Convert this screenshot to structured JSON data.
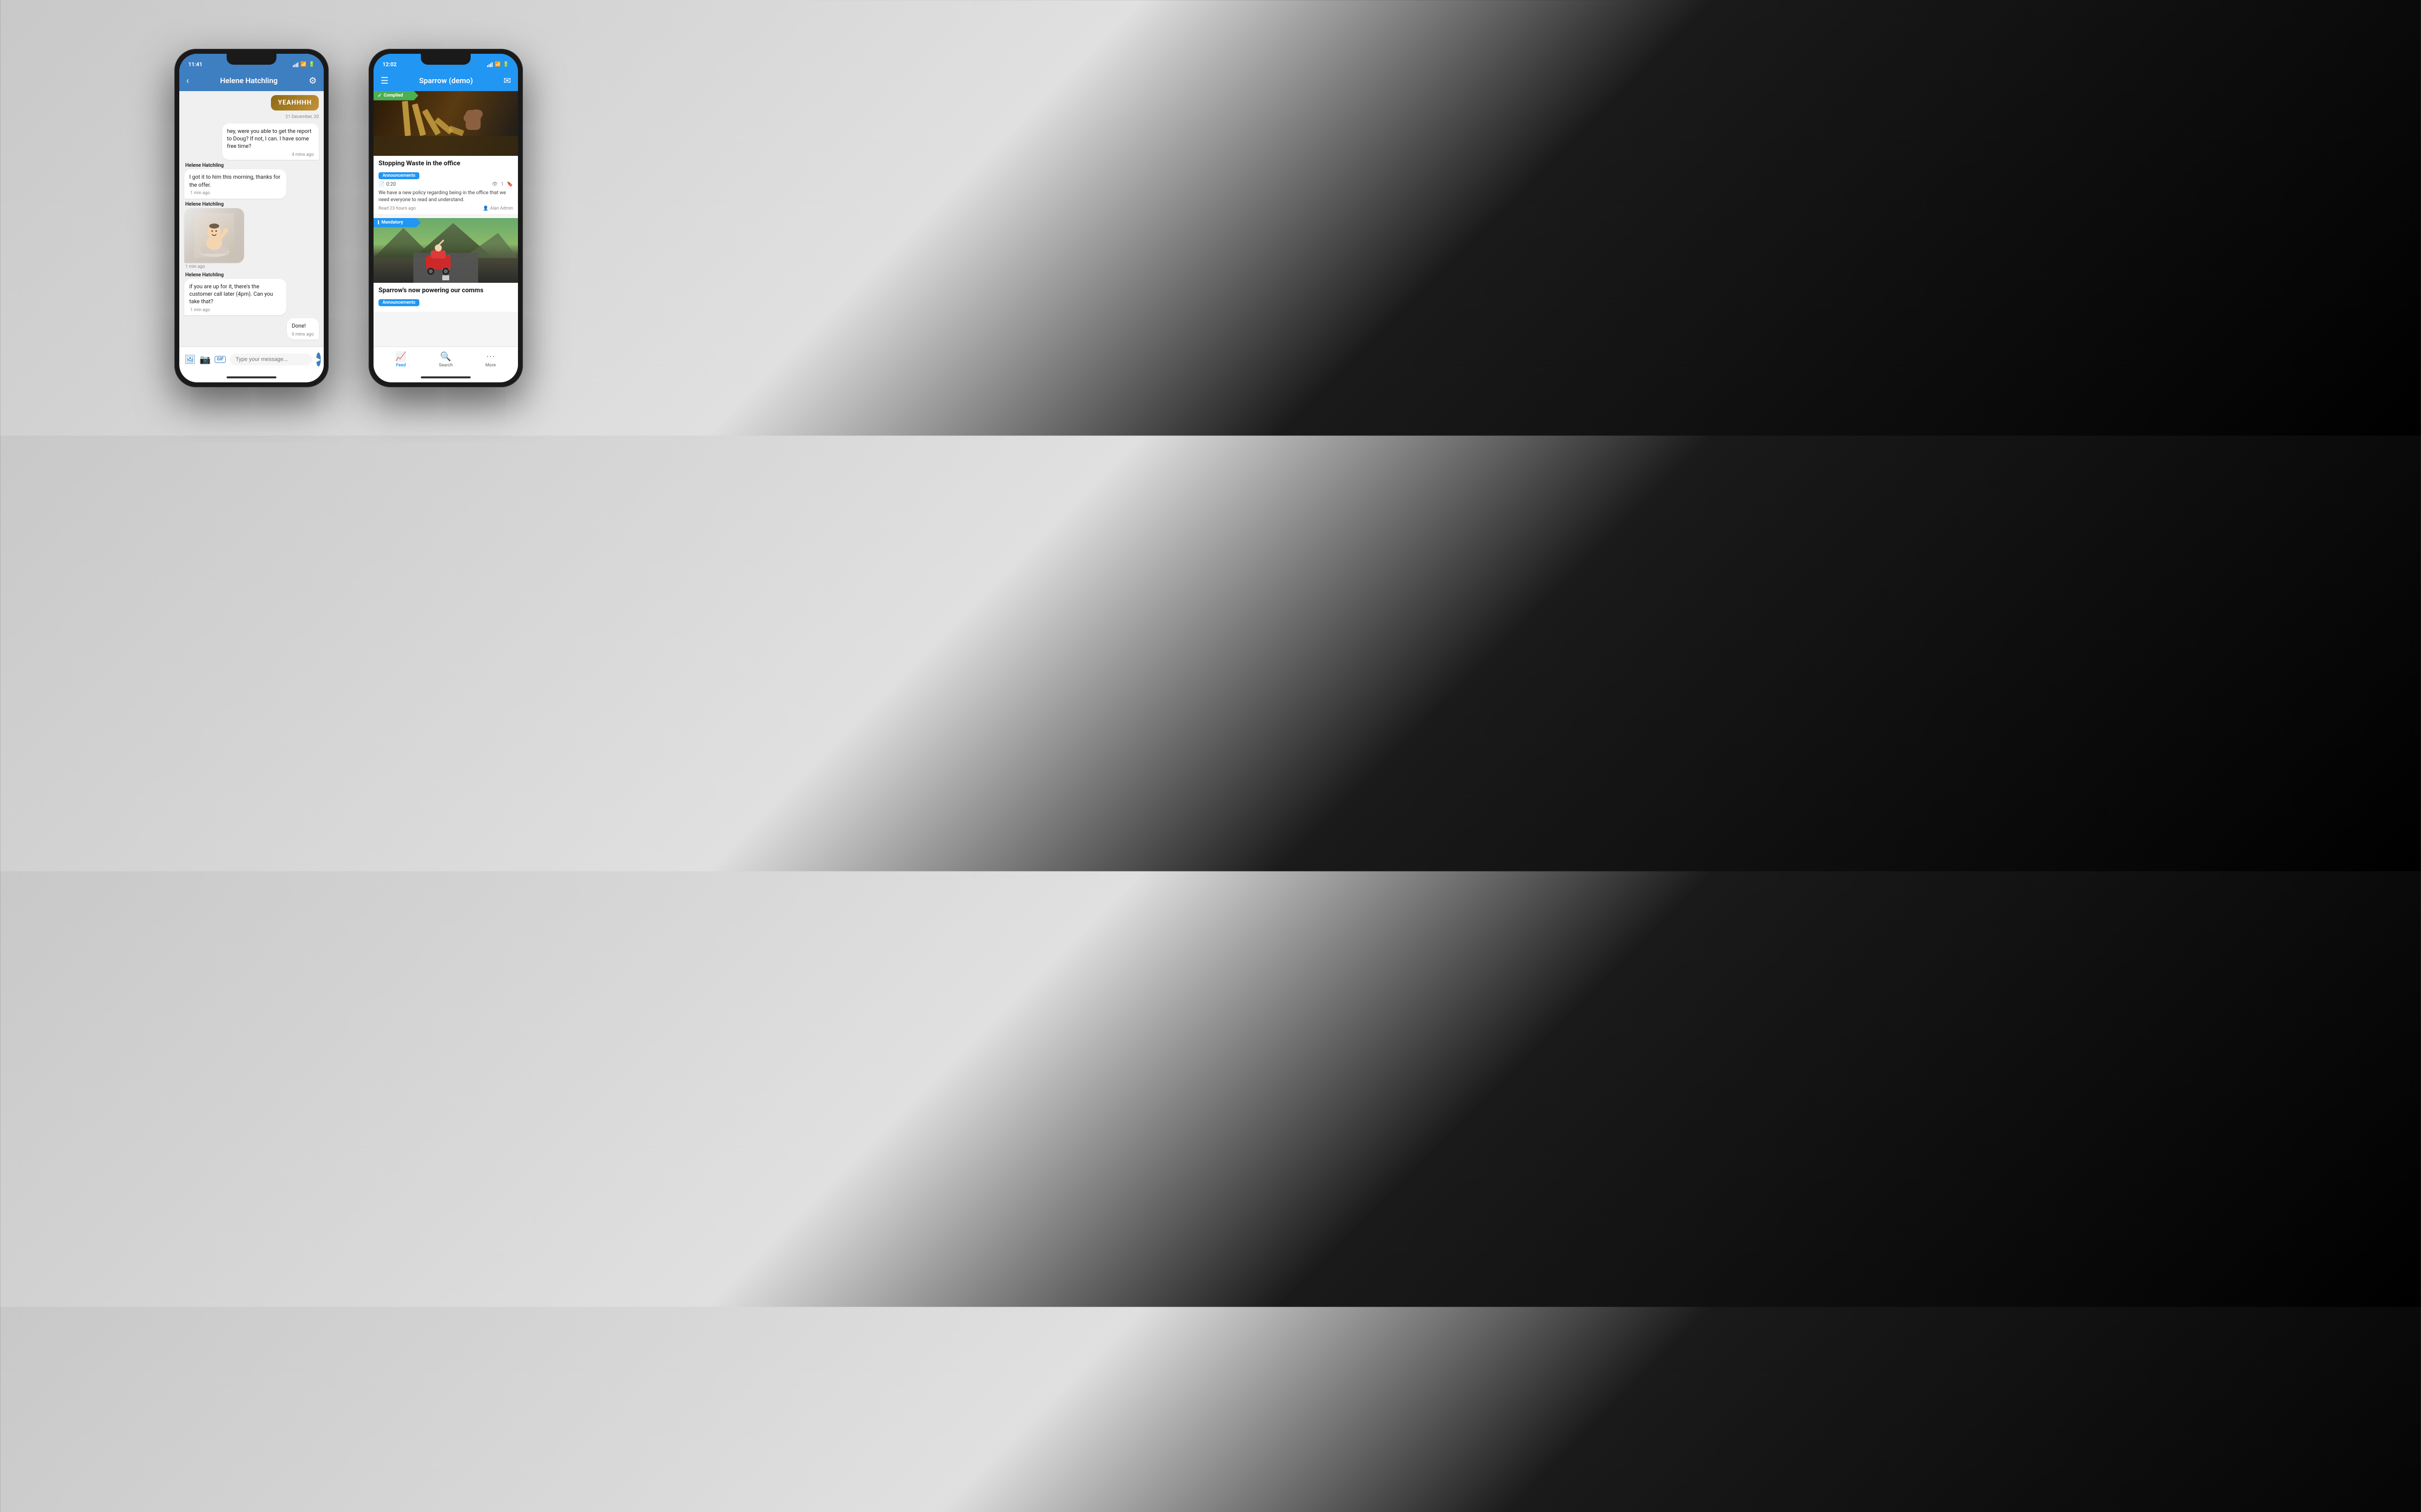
{
  "phone1": {
    "status": {
      "time": "11:41",
      "location_arrow": "▶"
    },
    "header": {
      "back_label": "‹",
      "title": "Helene Hatchling",
      "settings_icon": "⚙"
    },
    "messages": [
      {
        "id": "msg1",
        "type": "sent_image",
        "label": "YEAHHHH",
        "date": "21 December, 20"
      },
      {
        "id": "msg2",
        "type": "sent_text",
        "text": "hey, were you able to get the report to Doug? If not, I can. I have some free time?",
        "time": "4 mins ago"
      },
      {
        "id": "msg3",
        "type": "received_text",
        "sender": "Helene Hatchling",
        "text": "I got it to him this morning, thanks for the offer.",
        "time": "1 min ago"
      },
      {
        "id": "msg4",
        "type": "received_image",
        "sender": "Helene Hatchling",
        "time": "1 min ago"
      },
      {
        "id": "msg5",
        "type": "received_text",
        "sender": "Helene Hatchling",
        "text": "if you are up for it, there's the customer call later (4pm). Can you take that?",
        "time": "1 min ago"
      },
      {
        "id": "msg6",
        "type": "sent_text",
        "text": "Done!",
        "time": "0 mins ago"
      }
    ],
    "input": {
      "placeholder": "Type your message...",
      "gif_label": "GIF"
    }
  },
  "phone2": {
    "status": {
      "time": "12:02",
      "location_arrow": "▶"
    },
    "header": {
      "menu_icon": "☰",
      "title": "Sparrow (demo)",
      "compose_icon": "✉"
    },
    "feed": [
      {
        "id": "card1",
        "badge": "Complied",
        "badge_type": "complied",
        "title": "Stopping Waste in the office",
        "tag": "Announcements",
        "duration": "0:20",
        "view_count": "1",
        "description": "We have a new policy regarding being in the office that we need everyone to read and understand.",
        "read_time": "Read 23 hours ago",
        "author": "Alan Admin"
      },
      {
        "id": "card2",
        "badge": "Mandatory",
        "badge_type": "mandatory",
        "title": "Sparrow's now powering our comms",
        "tag": "Announcements"
      }
    ],
    "tabs": [
      {
        "id": "feed",
        "label": "Feed",
        "icon": "📈",
        "active": true
      },
      {
        "id": "search",
        "label": "Search",
        "icon": "🔍",
        "active": false
      },
      {
        "id": "more",
        "label": "More",
        "icon": "⋯",
        "active": false
      }
    ]
  }
}
